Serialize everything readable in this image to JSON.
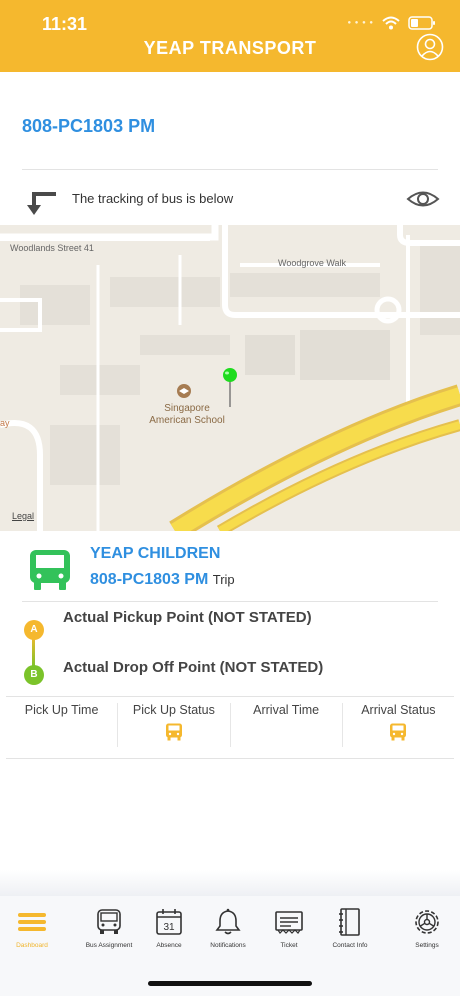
{
  "status_bar": {
    "time": "11:31"
  },
  "header": {
    "title": "YEAP TRANSPORT"
  },
  "trip": {
    "code": "808-PC1803 PM"
  },
  "tracking": {
    "text": "The tracking of bus is below"
  },
  "map": {
    "street_1": "Woodlands Street 41",
    "street_2": "Woodgrove Walk",
    "poi_line1": "Singapore",
    "poi_line2": "American School",
    "edge_label": "ay",
    "legal": "Legal"
  },
  "card": {
    "org_name": "YEAP CHILDREN",
    "trip_code": "808-PC1803 PM",
    "trip_suffix": "Trip",
    "point_a": "A",
    "point_b": "B",
    "pickup": "Actual Pickup Point (NOT STATED)",
    "dropoff": "Actual Drop Off Point (NOT STATED)"
  },
  "status_table": {
    "columns": [
      "Pick Up Time",
      "Pick Up Status",
      "Arrival Time",
      "Arrival Status"
    ]
  },
  "tabbar": {
    "items": [
      {
        "label": "Dashboard",
        "icon": "menu-icon",
        "active": true
      },
      {
        "label": "Bus Assignment",
        "icon": "bus-icon"
      },
      {
        "label": "Absence",
        "icon": "calendar-icon",
        "day": "31"
      },
      {
        "label": "Notifications",
        "icon": "bell-icon"
      },
      {
        "label": "Ticket",
        "icon": "ticket-icon"
      },
      {
        "label": "Contact Info",
        "icon": "notebook-icon"
      },
      {
        "label": "Settings",
        "icon": "gear-icon"
      }
    ]
  },
  "colors": {
    "brand": "#f5b82e",
    "accent_blue": "#2f8fe0",
    "bus_green": "#33c25a",
    "point_b_green": "#7bc32a",
    "pin_green": "#1edc1e"
  }
}
